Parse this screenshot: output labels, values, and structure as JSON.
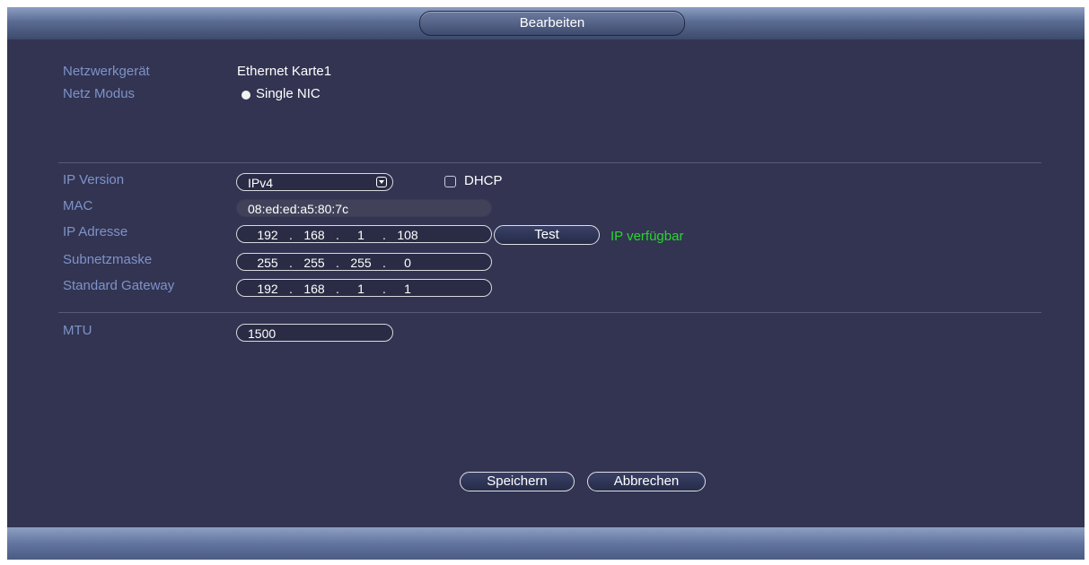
{
  "dialog": {
    "title": "Bearbeiten"
  },
  "network": {
    "device_label": "Netzwerkgerät",
    "device_value": "Ethernet Karte1",
    "mode_label": "Netz Modus",
    "mode_option": "Single NIC"
  },
  "ip": {
    "version_label": "IP Version",
    "version_value": "IPv4",
    "dhcp_label": "DHCP",
    "dhcp_checked": false,
    "mac_label": "MAC",
    "mac_value": "08:ed:ed:a5:80:7c",
    "address_label": "IP Adresse",
    "address": [
      "192",
      "168",
      "1",
      "108"
    ],
    "test_label": "Test",
    "test_status": "IP verfügbar",
    "subnet_label": "Subnetzmaske",
    "subnet": [
      "255",
      "255",
      "255",
      "0"
    ],
    "gateway_label": "Standard Gateway",
    "gateway": [
      "192",
      "168",
      "1",
      "1"
    ]
  },
  "mtu": {
    "label": "MTU",
    "value": "1500"
  },
  "actions": {
    "save": "Speichern",
    "cancel": "Abbrechen"
  },
  "colors": {
    "background": "#323452",
    "label": "#7e93c8",
    "status_ok": "#29d62c"
  }
}
